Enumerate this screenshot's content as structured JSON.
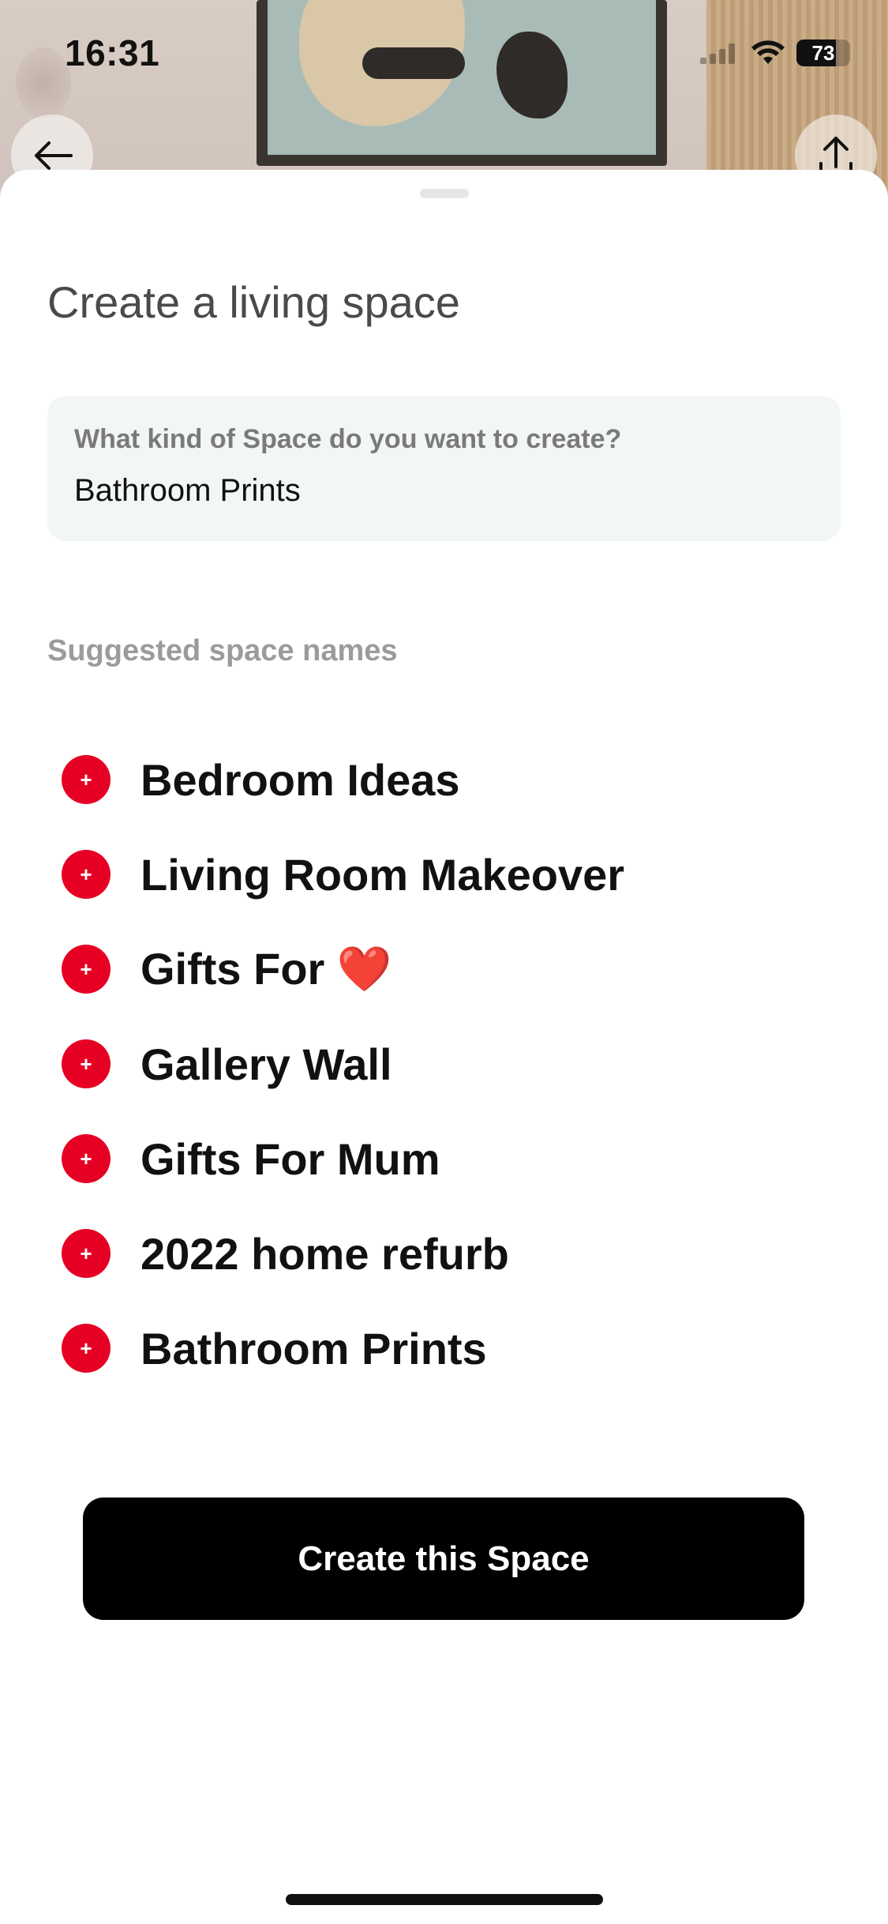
{
  "status_bar": {
    "time": "16:31",
    "battery": "73",
    "battery_level_percent": 73,
    "wifi_icon": "wifi-icon",
    "signal_icon": "signal-icon"
  },
  "top_buttons": {
    "back_icon": "arrow-left-icon",
    "share_icon": "share-up-icon"
  },
  "sheet": {
    "title": "Create a living space",
    "input": {
      "label": "What kind of Space do you want to create?",
      "value": "Bathroom Prints"
    },
    "suggestions_heading": "Suggested space names",
    "suggestions": [
      {
        "label": "Bedroom Ideas"
      },
      {
        "label": "Living Room Makeover"
      },
      {
        "label": "Gifts For ❤️"
      },
      {
        "label": "Gallery Wall"
      },
      {
        "label": "Gifts For Mum"
      },
      {
        "label": "2022 home refurb"
      },
      {
        "label": "Bathroom Prints"
      }
    ],
    "add_icon": "+",
    "create_button_label": "Create this Space"
  },
  "colors": {
    "accent_red": "#e60023",
    "button_black": "#000000",
    "input_bg": "#f3f6f7"
  }
}
